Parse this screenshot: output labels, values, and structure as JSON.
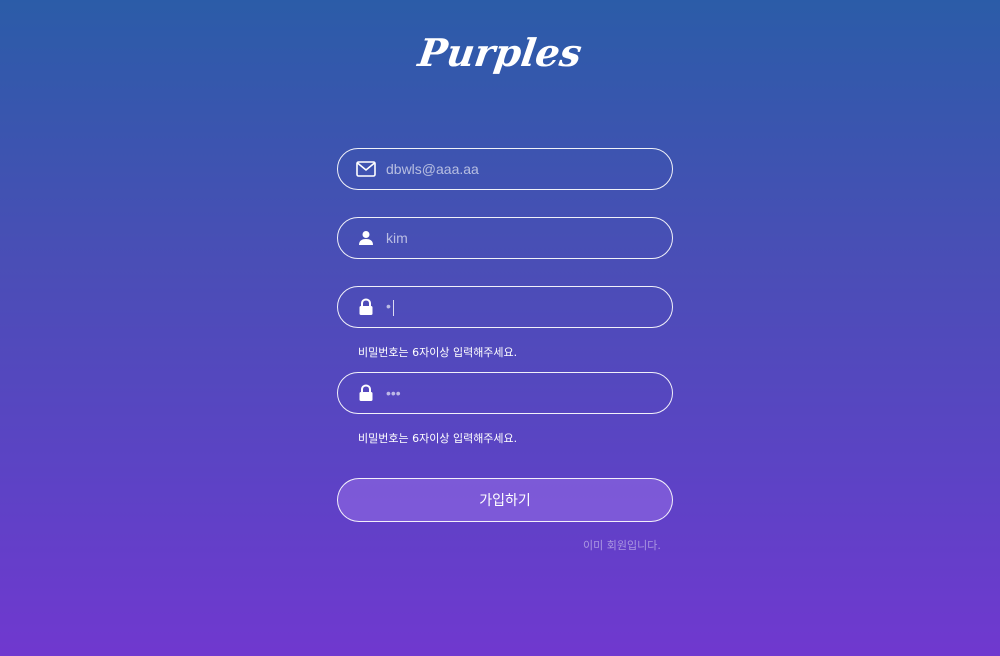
{
  "logo": {
    "text": "Purples"
  },
  "form": {
    "email": {
      "value": "dbwls@aaa.aa",
      "icon": "mail-icon"
    },
    "name": {
      "value": "kim",
      "icon": "user-icon"
    },
    "password": {
      "value": "•",
      "icon": "lock-icon",
      "hint": "비밀번호는 6자이상 입력해주세요."
    },
    "password_confirm": {
      "value": "•••",
      "icon": "lock-icon",
      "hint": "비밀번호는 6자이상 입력해주세요."
    },
    "submit_label": "가입하기",
    "login_link": "이미 회원입니다."
  },
  "colors": {
    "gradient_top": "#2b5ca8",
    "gradient_bottom": "#7038cf",
    "text": "#ffffff"
  }
}
